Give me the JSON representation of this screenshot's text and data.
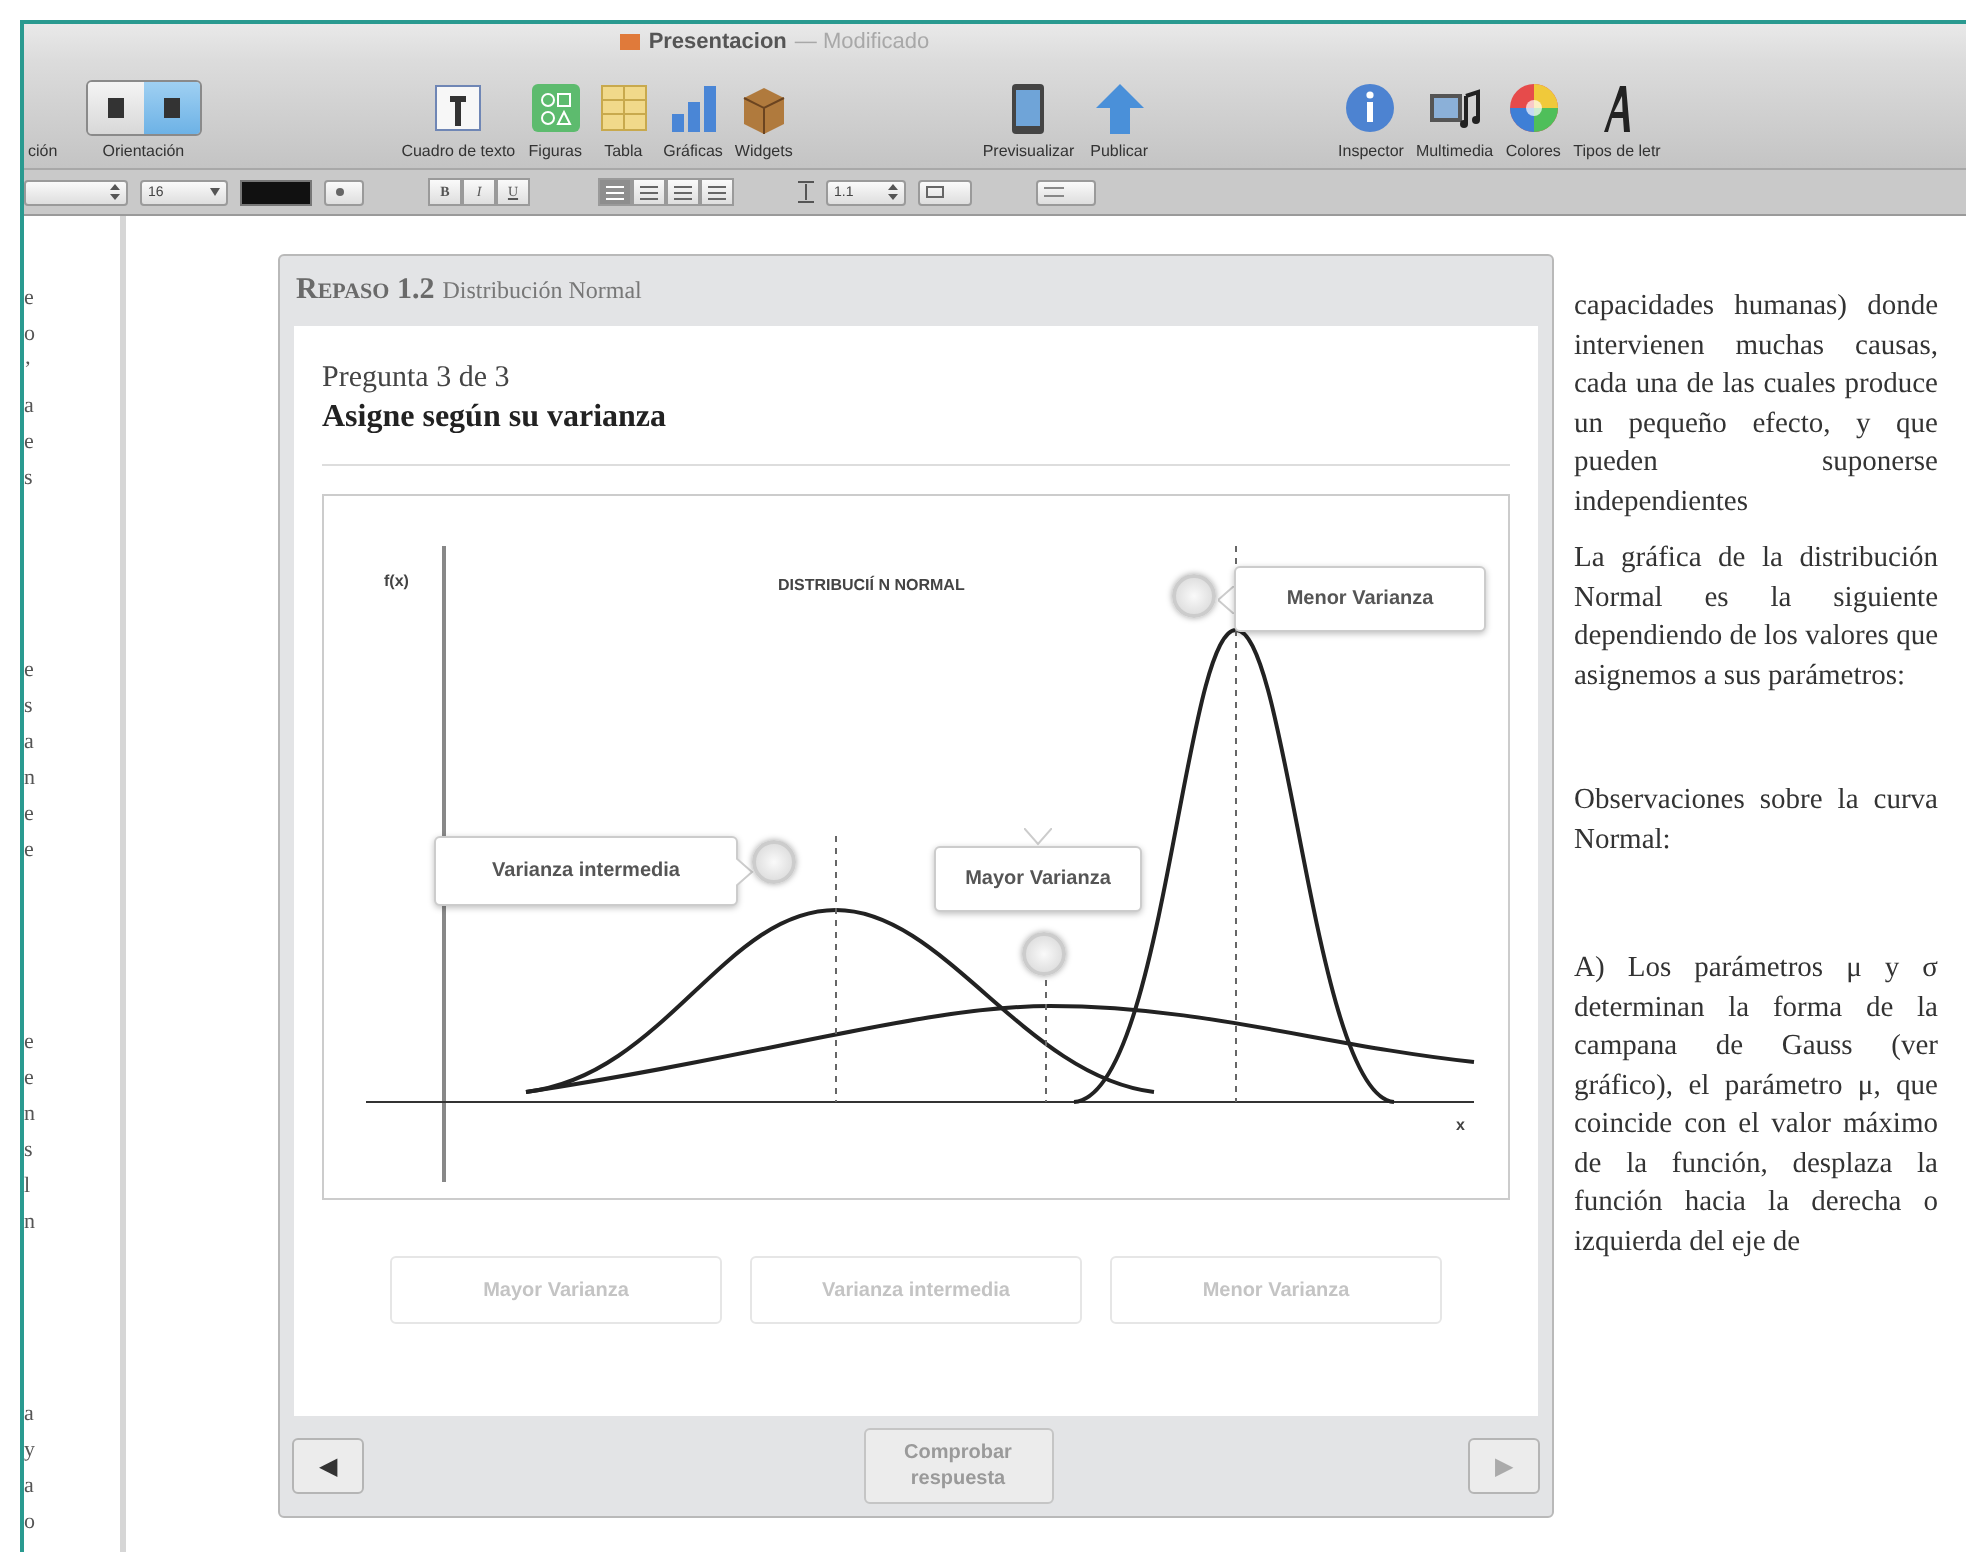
{
  "window": {
    "title": "Presentacion",
    "status": "— Modificado"
  },
  "toolbar": {
    "items": [
      {
        "kind": "cut",
        "label": "ción"
      },
      {
        "kind": "segmented",
        "label": "Orientación",
        "options": [
          {
            "selected": false
          },
          {
            "selected": true
          }
        ]
      },
      {
        "kind": "tool",
        "label": "Cuadro de texto"
      },
      {
        "kind": "tool",
        "label": "Figuras"
      },
      {
        "kind": "tool",
        "label": "Tabla"
      },
      {
        "kind": "tool",
        "label": "Gráficas"
      },
      {
        "kind": "tool",
        "label": "Widgets"
      },
      {
        "kind": "tool",
        "label": "Previsualizar"
      },
      {
        "kind": "tool",
        "label": "Publicar"
      },
      {
        "kind": "tool",
        "label": "Inspector"
      },
      {
        "kind": "tool",
        "label": "Multimedia"
      },
      {
        "kind": "tool",
        "label": "Colores"
      },
      {
        "kind": "tool",
        "label": "Tipos de letr"
      }
    ]
  },
  "format_bar": {
    "font_size": "16",
    "style_buttons": [
      {
        "label": "B"
      },
      {
        "label": "I"
      },
      {
        "label": "U"
      }
    ],
    "alignment": [
      {
        "selected": true
      },
      {
        "selected": false
      },
      {
        "selected": false
      },
      {
        "selected": false
      }
    ],
    "line_spacing": "1.1"
  },
  "left_margin_fragments": [
    [
      "e",
      "o",
      "’",
      "a",
      "e",
      "s"
    ],
    [
      "e",
      "s",
      "a",
      "n",
      "e",
      "e"
    ],
    [
      "e",
      "e",
      "n",
      "s",
      "l",
      "n"
    ],
    [
      "a",
      "y",
      "a",
      "o"
    ]
  ],
  "widget": {
    "header_small_caps": "Repaso 1.2",
    "header_title": "Distribución Normal",
    "question_counter": "Pregunta 3 de 3",
    "question": "Asigne según su varianza",
    "diagram": {
      "y_label": "f(x)",
      "title": "DISTRIBUCIÍ N NORMAL",
      "x_label": "x",
      "callouts": [
        {
          "label": "Menor Varianza",
          "kind": "right"
        },
        {
          "label": "Varianza intermedia",
          "kind": "left"
        },
        {
          "label": "Mayor Varianza",
          "kind": "above"
        }
      ]
    },
    "answers": [
      {
        "label": "Mayor Varianza",
        "disabled": true
      },
      {
        "label": "Varianza intermedia",
        "disabled": true
      },
      {
        "label": "Menor Varianza",
        "disabled": true
      }
    ],
    "prev_button": {
      "label": "◀",
      "disabled": false
    },
    "check_button": {
      "label": "Comprobar respuesta",
      "disabled": true
    },
    "next_button": {
      "label": "▶",
      "disabled": true
    }
  },
  "side_text": [
    "capacidades humanas) donde intervienen muchas causas, cada una de las cuales produce un pequeño efecto, y que pueden suponerse independientes",
    "La gráfica de la distribución Normal es la siguiente dependiendo de los valores que asignemos a sus parámetros:",
    "Observaciones sobre la curva Normal:",
    "A) Los parámetros μ y σ determinan la forma de la campana de Gauss (ver gráfico), el parámetro μ, que coincide con el valor máximo de la función, desplaza la función hacia la derecha o izquierda del eje de"
  ]
}
